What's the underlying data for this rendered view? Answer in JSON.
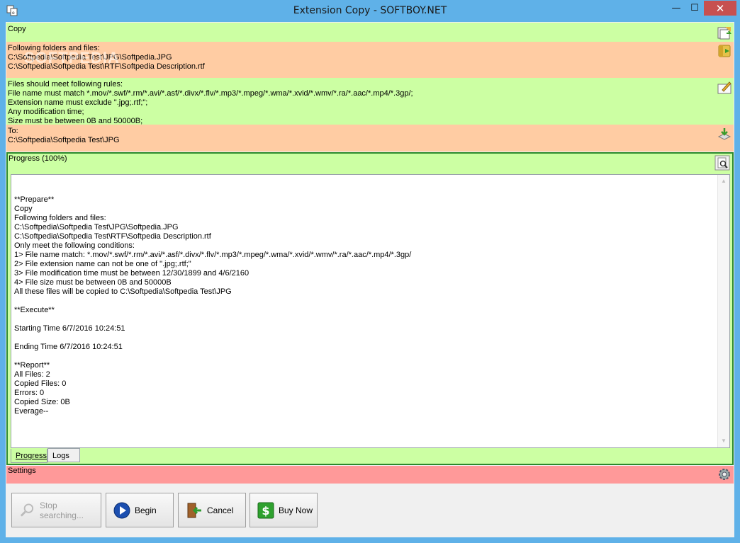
{
  "window": {
    "title": "Extension Copy  - SOFTBOY.NET",
    "minimize_glyph": "—",
    "maximize_glyph": "☐",
    "close_glyph": "✕",
    "watermark": "SOFTPEDIA"
  },
  "sections": {
    "copy": {
      "label": "Copy"
    },
    "source": {
      "lines": [
        "Following folders and files:",
        "C:\\Softpedia\\Softpedia Test\\JPG\\Softpedia.JPG",
        "C:\\Softpedia\\Softpedia Test\\RTF\\Softpedia Description.rtf"
      ]
    },
    "rules": {
      "lines": [
        "Files should meet following rules:",
        "File name must match *.mov/*.swf/*.rm/*.avi/*.asf/*.divx/*.flv/*.mp3/*.mpeg/*.wma/*.xvid/*.wmv/*.ra/*.aac/*.mp4/*.3gp/;",
        "Extension name must exclude \".jpg;.rtf;\";",
        "Any modification time;",
        "Size must be between 0B and 50000B;"
      ]
    },
    "destination": {
      "lines": [
        "To:",
        "C:\\Softpedia\\Softpedia Test\\JPG"
      ]
    },
    "progress": {
      "title": "Progress (100%)",
      "percent": 100,
      "log": "\n**Prepare**\nCopy\nFollowing folders and files:\nC:\\Softpedia\\Softpedia Test\\JPG\\Softpedia.JPG\nC:\\Softpedia\\Softpedia Test\\RTF\\Softpedia Description.rtf\nOnly meet the following conditions:\n1> File name match: *.mov/*.swf/*.rm/*.avi/*.asf/*.divx/*.flv/*.mp3/*.mpeg/*.wma/*.xvid/*.wmv/*.ra/*.aac/*.mp4/*.3gp/\n2> File extension name can not be one of \".jpg;.rtf;\"\n3> File modification time must be between 12/30/1899 and 4/6/2160\n4> File size must be between 0B and 50000B\nAll these files will be copied to C:\\Softpedia\\Softpedia Test\\JPG\n\n**Execute**\n\nStarting Time 6/7/2016 10:24:51\n\nEnding Time 6/7/2016 10:24:51\n\n**Report**\nAll Files: 2\nCopied Files: 0\nErrors: 0\nCopied Size: 0B\nEverage--",
      "tabs": [
        {
          "label": "Progress"
        },
        {
          "label": "Logs"
        }
      ]
    },
    "settings": {
      "label": "Settings"
    }
  },
  "buttons": {
    "stop": "Stop searching...",
    "begin": "Begin",
    "cancel": "Cancel",
    "buy": "Buy Now"
  },
  "colors": {
    "green": "#ccffa3",
    "salmon": "#ffcca3",
    "pink": "#ff9999",
    "titlebar": "#5fb1e8",
    "close": "#c75050"
  },
  "icons": {
    "app": "app-icon",
    "copy": "copy-folder-icon",
    "source": "add-folder-icon",
    "rules": "edit-rules-icon",
    "destination": "destination-icon",
    "progress": "zoom-log-icon",
    "settings": "gear-icon",
    "stop": "magnifier-icon",
    "begin": "play-icon",
    "cancel": "exit-door-icon",
    "buy": "dollar-icon"
  }
}
